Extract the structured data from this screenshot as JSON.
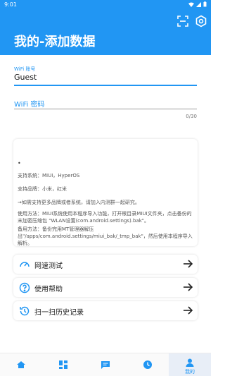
{
  "status_bar": {
    "time": "9:01"
  },
  "app_bar": {
    "title": "我的-添加数据",
    "scan_icon": "scan-icon",
    "settings_icon": "gear-icon"
  },
  "form": {
    "ssid": {
      "label": "WiFi 账号",
      "value": "Guest"
    },
    "password": {
      "placeholder": "WiFi 密码",
      "counter": "0/30"
    }
  },
  "info": {
    "bullet": "•",
    "lines": [
      "支持系统：MIUI，HyperOS",
      "支持品牌：小米，红米",
      "→如需支持更多品牌或者系统，请加入内测群一起研究。",
      "使用方法：MIUI系统使用本程序导入功能，打开根目录MIUI文件夹，点击备份的末加密压缩包 \"WLAN设置(com.android.settings).bak\"。",
      "备用方法：备份完用MT管理器解压出\"/apps/com.android.settings/miui_bak/_tmp_bak\"，然后使用本程序导入解析。"
    ]
  },
  "actions": [
    {
      "label": "网速测试",
      "icon": "speedometer-icon"
    },
    {
      "label": "使用帮助",
      "icon": "help-icon"
    },
    {
      "label": "扫一扫历史记录",
      "icon": "history-icon"
    }
  ],
  "bottom_nav": {
    "items": [
      {
        "icon": "home-icon",
        "label": ""
      },
      {
        "icon": "dashboard-icon",
        "label": ""
      },
      {
        "icon": "message-icon",
        "label": ""
      },
      {
        "icon": "clock-icon",
        "label": ""
      },
      {
        "icon": "person-icon",
        "label": "我的"
      }
    ],
    "active_index": 4
  },
  "colors": {
    "primary": "#2196F3",
    "text": "#222222"
  }
}
